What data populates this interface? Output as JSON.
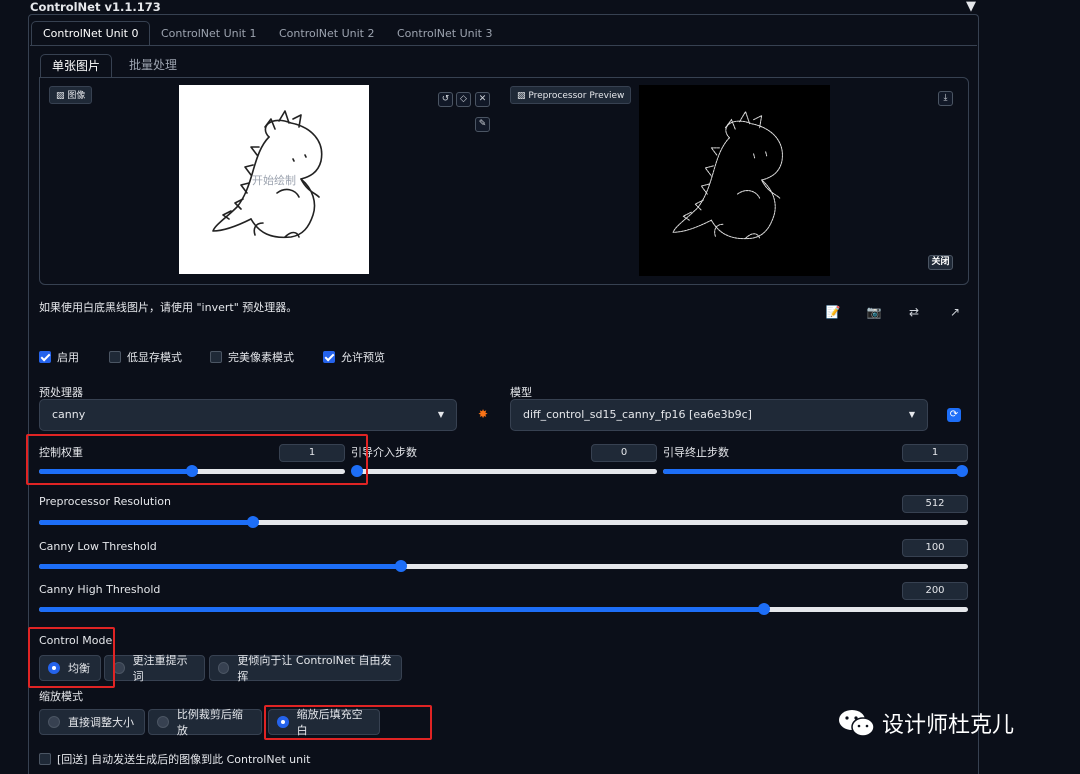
{
  "header": {
    "title": "ControlNet v1.1.173",
    "collapse_icon": "triangle-down-icon"
  },
  "tabs": [
    "ControlNet Unit 0",
    "ControlNet Unit 1",
    "ControlNet Unit 2",
    "ControlNet Unit 3"
  ],
  "subtabs": [
    "单张图片",
    "批量处理"
  ],
  "image_panel": {
    "image_label": "图像",
    "canvas_hint": "开始绘制",
    "preview_label": "Preprocessor Preview",
    "close_label": "关闭"
  },
  "note": "如果使用白底黑线图片，请使用 \"invert\" 预处理器。",
  "checkboxes": [
    {
      "label": "启用",
      "checked": true
    },
    {
      "label": "低显存模式",
      "checked": false
    },
    {
      "label": "完美像素模式",
      "checked": false
    },
    {
      "label": "允许预览",
      "checked": true
    }
  ],
  "preprocessor": {
    "label": "预处理器",
    "value": "canny"
  },
  "model": {
    "label": "模型",
    "value": "diff_control_sd15_canny_fp16 [ea6e3b9c]"
  },
  "sliders": {
    "weight": {
      "label": "控制权重",
      "value": "1",
      "fraction": 0.5
    },
    "start": {
      "label": "引导介入步数",
      "value": "0",
      "fraction": 0.0
    },
    "end": {
      "label": "引导终止步数",
      "value": "1",
      "fraction": 1.0
    },
    "resolution": {
      "label": "Preprocessor Resolution",
      "value": "512",
      "fraction": 0.23
    },
    "low": {
      "label": "Canny Low Threshold",
      "value": "100",
      "fraction": 0.39
    },
    "high": {
      "label": "Canny High Threshold",
      "value": "200",
      "fraction": 0.78
    }
  },
  "control_mode": {
    "label": "Control Mode",
    "options": [
      "均衡",
      "更注重提示词",
      "更倾向于让 ControlNet 自由发挥"
    ],
    "selected": 0
  },
  "resize_mode": {
    "label": "缩放模式",
    "options": [
      "直接调整大小",
      "比例裁剪后缩放",
      "缩放后填充空白"
    ],
    "selected": 2
  },
  "loopback": {
    "label": "[回送] 自动发送生成后的图像到此 ControlNet unit",
    "checked": false
  },
  "watermark": "设计师杜克儿",
  "colors": {
    "accent": "#1d6ef7",
    "highlight": "#e02424",
    "background": "#0b0f19"
  }
}
